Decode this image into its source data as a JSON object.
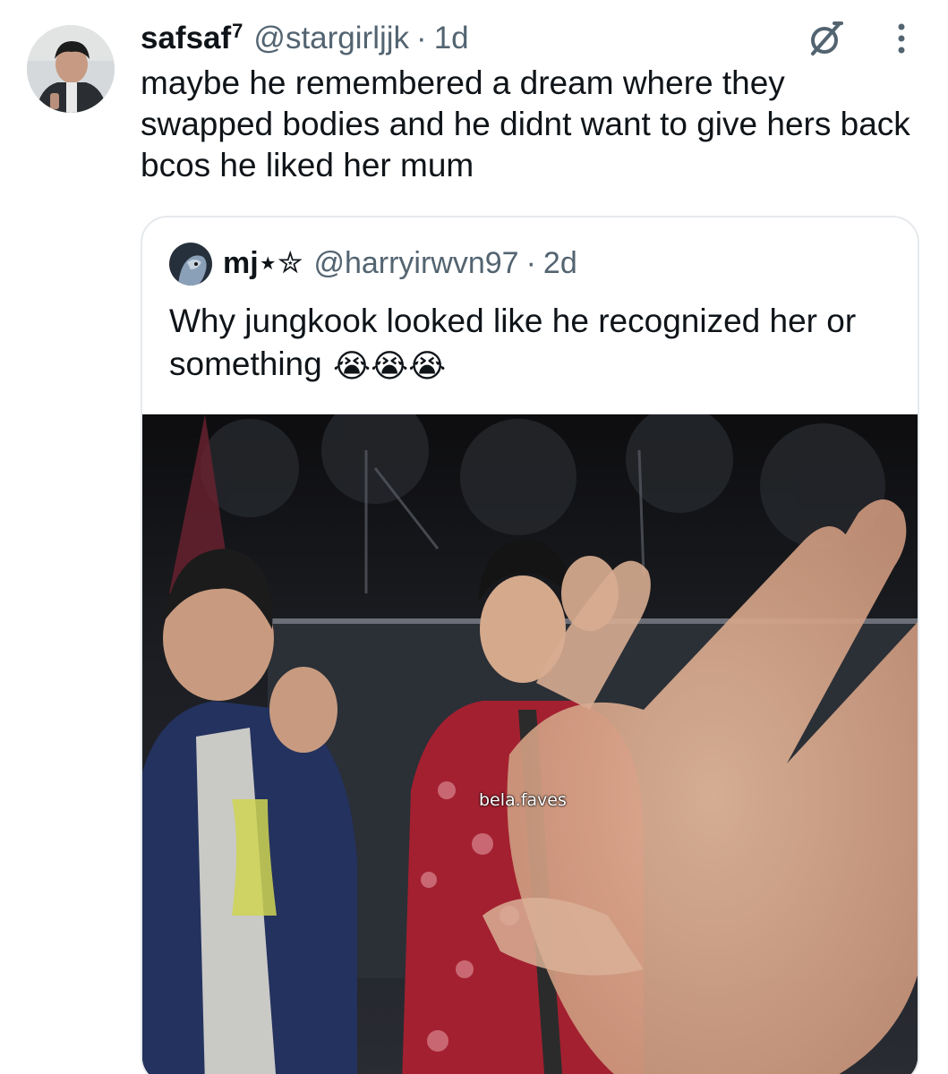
{
  "tweet": {
    "display_name": "safsaf",
    "badge": "7",
    "handle": "@stargirljjk",
    "separator": "·",
    "time": "1d",
    "text": "maybe he remembered a dream where they swapped bodies and he didnt want to give hers back bcos he liked her mum",
    "icons": {
      "grok": "grok-icon",
      "more": "more-options-icon"
    }
  },
  "quote": {
    "display_name": "mj⋆✮",
    "handle": "@harryirwvn97",
    "separator": "·",
    "time": "2d",
    "text": "Why jungkook looked like he recognized her or something",
    "emoji": "😭😭😭",
    "media": {
      "watermark": "bela.faves"
    }
  },
  "colors": {
    "text": "#0f1419",
    "secondary": "#536471",
    "border": "#e6e9ec"
  }
}
